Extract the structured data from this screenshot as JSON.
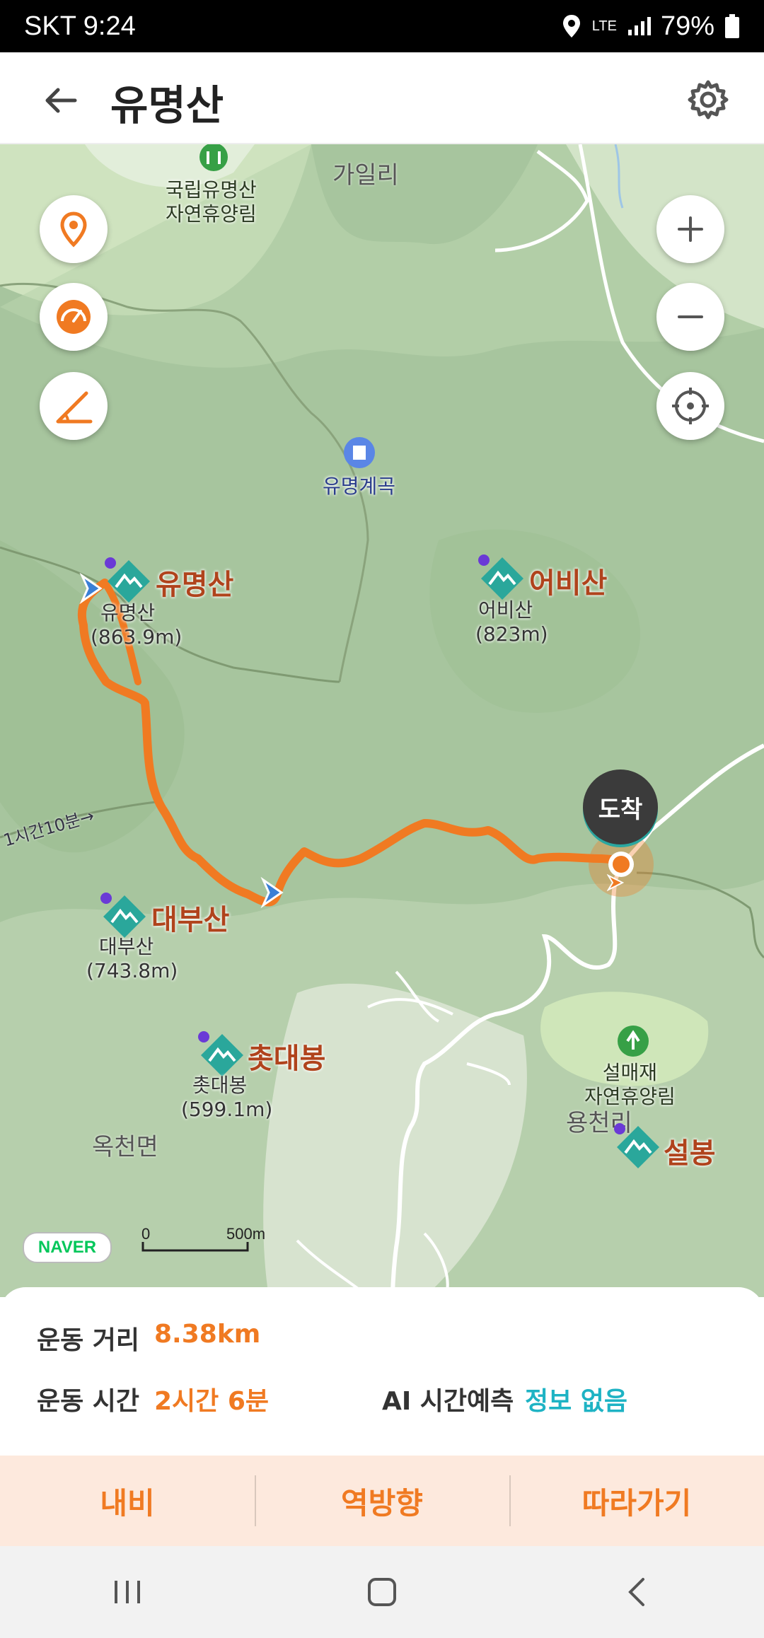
{
  "status_bar": {
    "carrier_time": "SKT 9:24",
    "network": "LTE",
    "battery": "79%"
  },
  "app_bar": {
    "title": "유명산"
  },
  "map": {
    "places": {
      "gailri": "가일리",
      "okcheon": "옥천면",
      "yongcheon": "용천리"
    },
    "forests": {
      "yumyeong_forest": "국립유명산\n자연휴양림",
      "seolmae_forest": "설매재\n자연휴양림"
    },
    "poi": {
      "valley": "유명계곡"
    },
    "peaks": [
      {
        "name": "유명산",
        "sub_name": "유명산",
        "elevation": "(863.9m)"
      },
      {
        "name": "어비산",
        "sub_name": "어비산",
        "elevation": "(823m)"
      },
      {
        "name": "대부산",
        "sub_name": "대부산",
        "elevation": "(743.8m)"
      },
      {
        "name": "촛대봉",
        "sub_name": "촛대봉",
        "elevation": "(599.1m)"
      },
      {
        "name": "설봉"
      }
    ],
    "trail_note": "1시간10분→",
    "arrival_label": "도착",
    "provider": "NAVER",
    "scale": {
      "start": "0",
      "end": "500m"
    }
  },
  "stats": {
    "distance_label": "운동 거리",
    "distance_value": "8.38km",
    "time_label": "운동 시간",
    "time_value": "2시간 6분",
    "ai_label": "AI 시간예측",
    "ai_value": "정보 없음"
  },
  "actions": {
    "navi": "내비",
    "reverse": "역방향",
    "follow": "따라가기"
  },
  "colors": {
    "route": "#f07a22",
    "accent_teal": "#1eb3c4",
    "peak_icon": "#2aa79b"
  }
}
